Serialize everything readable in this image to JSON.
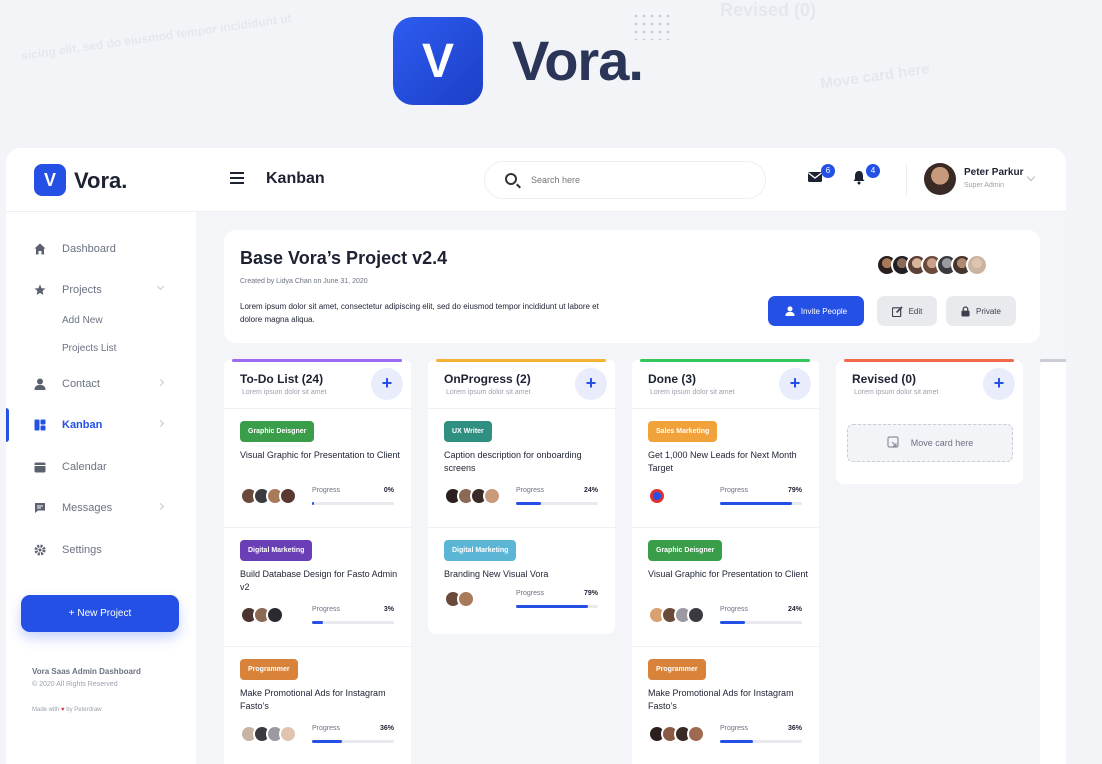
{
  "hero": {
    "title": "Vora.",
    "logo_letter": "V"
  },
  "topbar": {
    "brand": "Vora.",
    "brand_letter": "V",
    "page_title": "Kanban",
    "search_placeholder": "Search here",
    "mail_badge": "6",
    "bell_badge": "4",
    "user_name": "Peter Parkur",
    "user_role": "Super Admin"
  },
  "sidebar": {
    "items": [
      {
        "label": "Dashboard",
        "icon": "home-icon"
      },
      {
        "label": "Projects",
        "icon": "star-icon"
      },
      {
        "label": "Contact",
        "icon": "user-icon"
      },
      {
        "label": "Kanban",
        "icon": "kanban-icon"
      },
      {
        "label": "Calendar",
        "icon": "calendar-icon"
      },
      {
        "label": "Messages",
        "icon": "message-icon"
      },
      {
        "label": "Settings",
        "icon": "gear-icon"
      }
    ],
    "sub_items": [
      "Add New",
      "Projects List"
    ],
    "new_project": "+ New Project",
    "footer_title": "Vora Saas Admin Dashboard",
    "footer_copy": "© 2020 All Rights Reserved",
    "footer_made_pre": "Made with",
    "footer_made_post": "by Peterdraw"
  },
  "project": {
    "title": "Base Vora’s Project v2.4",
    "meta": "Created by Lidya Chan on June 31, 2020",
    "description": "Lorem ipsum dolor sit amet, consectetur adipiscing elit, sed do eiusmod tempor incididunt ut labore et dolore magna aliqua.",
    "invite": "Invite People",
    "edit": "Edit",
    "private": "Private"
  },
  "colors": {
    "accent": "#2450e6",
    "todo": "#9b6bf2",
    "progress": "#f5b335",
    "done": "#34c759",
    "revised": "#f06a4a"
  },
  "columns": [
    {
      "title": "To-Do List (24)",
      "sub": "Lorem ipsum dolor sit amet",
      "tasks": [
        {
          "tag": "Graphic Deisgner",
          "tag_color": "#3a9d4a",
          "title": "Visual Graphic for Presentation to Client",
          "progress_label": "Progress",
          "progress": "0%",
          "pct": 2
        },
        {
          "tag": "Digital Marketing",
          "tag_color": "#6a3fb5",
          "title": "Build Database Design for Fasto Admin v2",
          "progress_label": "Progress",
          "progress": "3%",
          "pct": 14
        },
        {
          "tag": "Programmer",
          "tag_color": "#d9823a",
          "title": "Make Promotional Ads for Instagram Fasto’s",
          "progress_label": "Progress",
          "progress": "36%",
          "pct": 36
        }
      ]
    },
    {
      "title": "OnProgress (2)",
      "sub": "Lorem ipsum dolor sit amet",
      "tasks": [
        {
          "tag": "UX Writer",
          "tag_color": "#2f8f80",
          "title": "Caption description for onboarding screens",
          "progress_label": "Progress",
          "progress": "24%",
          "pct": 30
        },
        {
          "tag": "Digital Marketing",
          "tag_color": "#5bb6d6",
          "title": "Branding New Visual Vora",
          "progress_label": "Progress",
          "progress": "79%",
          "pct": 88
        }
      ]
    },
    {
      "title": "Done (3)",
      "sub": "Lorem ipsum dolor sit amet",
      "tasks": [
        {
          "tag": "Sales Marketing",
          "tag_color": "#f2a23a",
          "title": "Get 1,000 New Leads for Next Month Target",
          "progress_label": "Progress",
          "progress": "79%",
          "pct": 88
        },
        {
          "tag": "Graphic Deisgner",
          "tag_color": "#3a9d4a",
          "title": "Visual Graphic for Presentation to Client",
          "progress_label": "Progress",
          "progress": "24%",
          "pct": 30
        },
        {
          "tag": "Programmer",
          "tag_color": "#d9823a",
          "title": "Make Promotional Ads for Instagram Fasto’s",
          "progress_label": "Progress",
          "progress": "36%",
          "pct": 40
        }
      ]
    },
    {
      "title": "Revised (0)",
      "sub": "Lorem ipsum dolor sit amet",
      "move": "Move card here"
    }
  ]
}
